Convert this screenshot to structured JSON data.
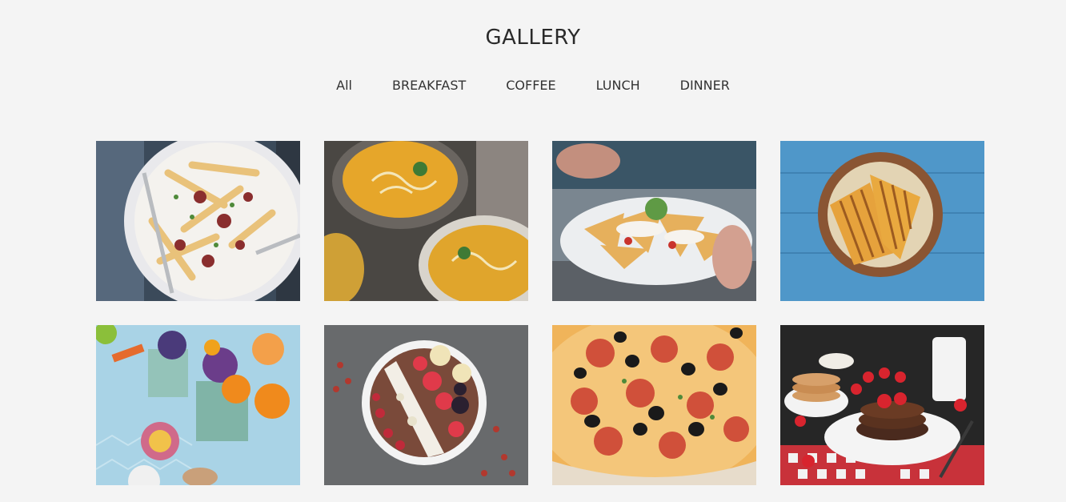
{
  "gallery": {
    "title": "GALLERY",
    "filters": [
      "All",
      "BREAKFAST",
      "COFFEE",
      "LUNCH",
      "DINNER"
    ],
    "items": [
      {
        "icon": "loaded-fries-photo"
      },
      {
        "icon": "soup-bowls-photo"
      },
      {
        "icon": "nachos-plate-photo"
      },
      {
        "icon": "grilled-sandwich-photo"
      },
      {
        "icon": "fruit-smoothie-photo"
      },
      {
        "icon": "acai-bowl-photo"
      },
      {
        "icon": "pepperoni-pizza-photo"
      },
      {
        "icon": "pancakes-strawberries-photo"
      }
    ]
  },
  "colors": {
    "background": "#f4f4f4",
    "text": "#2b2b2b"
  }
}
